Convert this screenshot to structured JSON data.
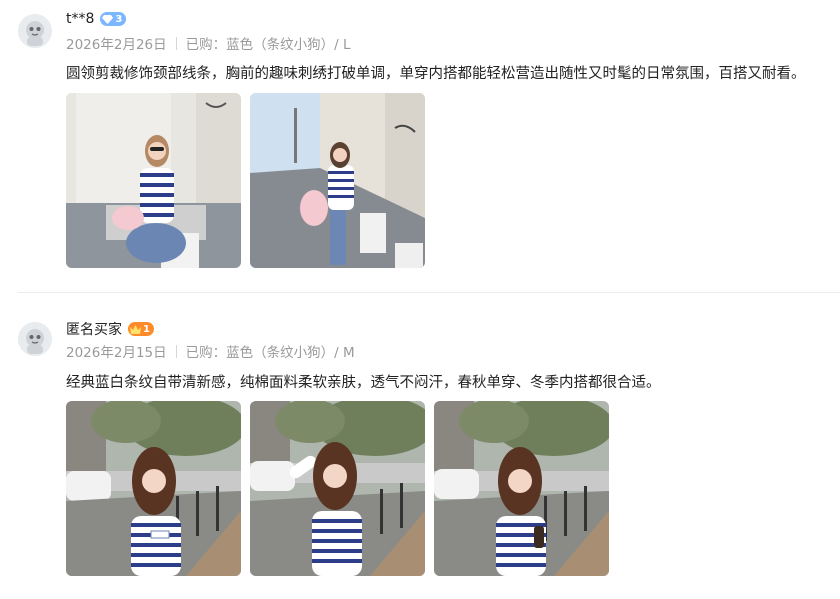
{
  "reviews": [
    {
      "username": "t**8",
      "badge": "3",
      "date": "2026年2月26日",
      "purchase": "已购：蓝色（条纹小狗）/ L",
      "text": "圆领剪裁修饰颈部线条，胸前的趣味刺绣打破单调，单穿内搭都能轻松营造出随性又时髦的日常氛围，百搭又耐看。"
    },
    {
      "username": "匿名买家",
      "badge": "1",
      "date": "2026年2月15日",
      "purchase": "已购：蓝色（条纹小狗）/ M",
      "text": "经典蓝白条纹自带清新感，纯棉面料柔软亲肤，透气不闷汗，春秋单穿、冬季内搭都很合适。"
    }
  ],
  "colors": {
    "badge_blue": "#7bb7ff",
    "badge_orange": "#ff8a2a",
    "meta_gray": "#9a9a9a"
  }
}
